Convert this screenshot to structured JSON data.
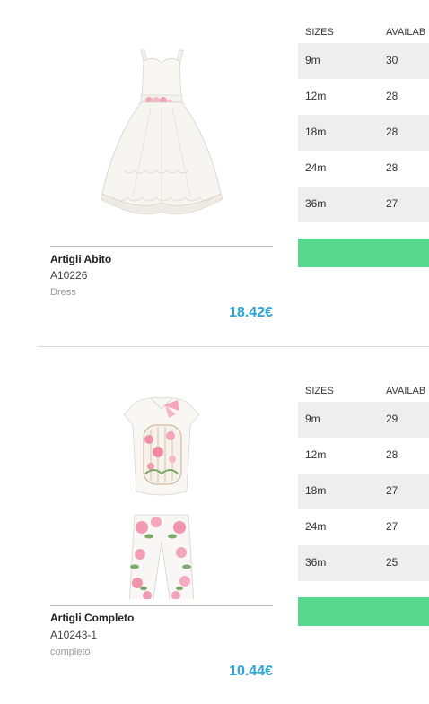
{
  "products": [
    {
      "name": "Artigli Abito",
      "sku": "A10226",
      "category": "Dress",
      "price": "18.42€",
      "image": "white-dress-image",
      "table": {
        "headers": [
          "SIZES",
          "AVAILAB"
        ],
        "rows": [
          {
            "size": "9m",
            "available": "30"
          },
          {
            "size": "12m",
            "available": "28"
          },
          {
            "size": "18m",
            "available": "28"
          },
          {
            "size": "24m",
            "available": "28"
          },
          {
            "size": "36m",
            "available": "27"
          }
        ]
      },
      "button_color": "#58d88f"
    },
    {
      "name": "Artigli Completo",
      "sku": "A10243-1",
      "category": "completo",
      "price": "10.44€",
      "image": "floral-outfit-image",
      "table": {
        "headers": [
          "SIZES",
          "AVAILAB"
        ],
        "rows": [
          {
            "size": "9m",
            "available": "29"
          },
          {
            "size": "12m",
            "available": "28"
          },
          {
            "size": "18m",
            "available": "27"
          },
          {
            "size": "24m",
            "available": "27"
          },
          {
            "size": "36m",
            "available": "25"
          }
        ]
      },
      "button_color": "#58d88f"
    }
  ],
  "colors": {
    "price": "#2aa3d6",
    "row_shade": "#eeeeee",
    "accent_green": "#58d88f"
  }
}
